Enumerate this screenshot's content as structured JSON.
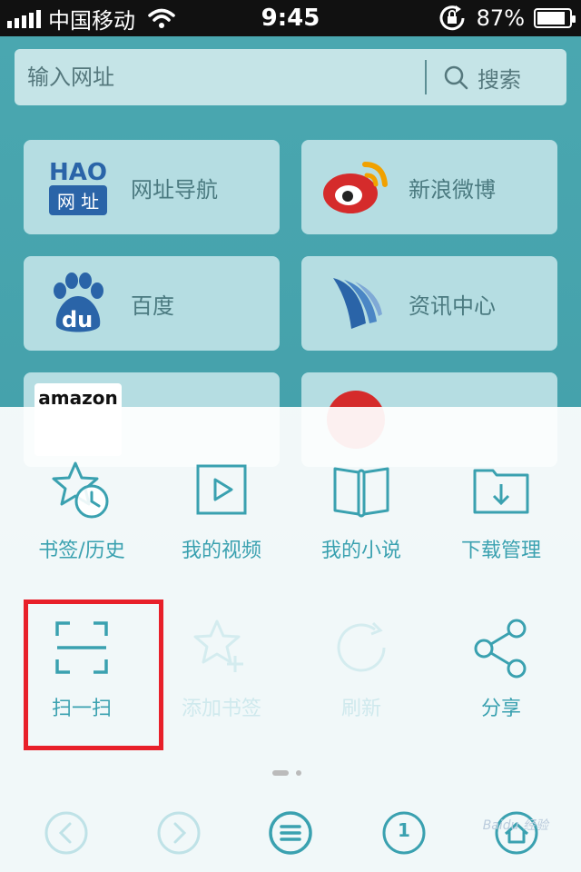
{
  "status_bar": {
    "carrier": "中国移动",
    "time": "9:45",
    "battery": "87%",
    "battery_level": 0.87,
    "icons": [
      "signal-icon",
      "wifi-icon",
      "rotation-lock-icon",
      "battery-icon"
    ]
  },
  "address_bar": {
    "placeholder": "输入网址",
    "search_label": "搜索"
  },
  "tiles": [
    {
      "label": "网址导航",
      "logo_text": "HAO",
      "logo_sub": "网 址",
      "icon": "hao-logo-icon"
    },
    {
      "label": "新浪微博",
      "icon": "weibo-logo-icon"
    },
    {
      "label": "百度",
      "logo_text": "du",
      "icon": "baidu-logo-icon"
    },
    {
      "label": "资讯中心",
      "icon": "news-logo-icon"
    },
    {
      "label": "",
      "logo_text": "amazon",
      "icon": "amazon-logo-icon"
    },
    {
      "label": "",
      "icon": "youku-logo-icon"
    }
  ],
  "menu": {
    "items": [
      {
        "label": "书签/历史",
        "icon": "bookmark-history-icon",
        "enabled": true
      },
      {
        "label": "我的视频",
        "icon": "video-icon",
        "enabled": true
      },
      {
        "label": "我的小说",
        "icon": "book-icon",
        "enabled": true
      },
      {
        "label": "下载管理",
        "icon": "download-folder-icon",
        "enabled": true
      },
      {
        "label": "扫一扫",
        "icon": "scan-icon",
        "enabled": true
      },
      {
        "label": "添加书签",
        "icon": "add-bookmark-icon",
        "enabled": false
      },
      {
        "label": "刷新",
        "icon": "refresh-icon",
        "enabled": false
      },
      {
        "label": "分享",
        "icon": "share-icon",
        "enabled": true
      }
    ],
    "page_count": 2,
    "current_page": 1,
    "highlighted": "扫一扫"
  },
  "bottom_bar": {
    "buttons": [
      "back-icon",
      "forward-icon",
      "menu-icon",
      "tabs-icon",
      "home-icon"
    ],
    "tab_count": "1"
  },
  "colors": {
    "accent": "#3aa1b0",
    "highlight": "#e8202a"
  },
  "watermark": "Baidu 经验"
}
